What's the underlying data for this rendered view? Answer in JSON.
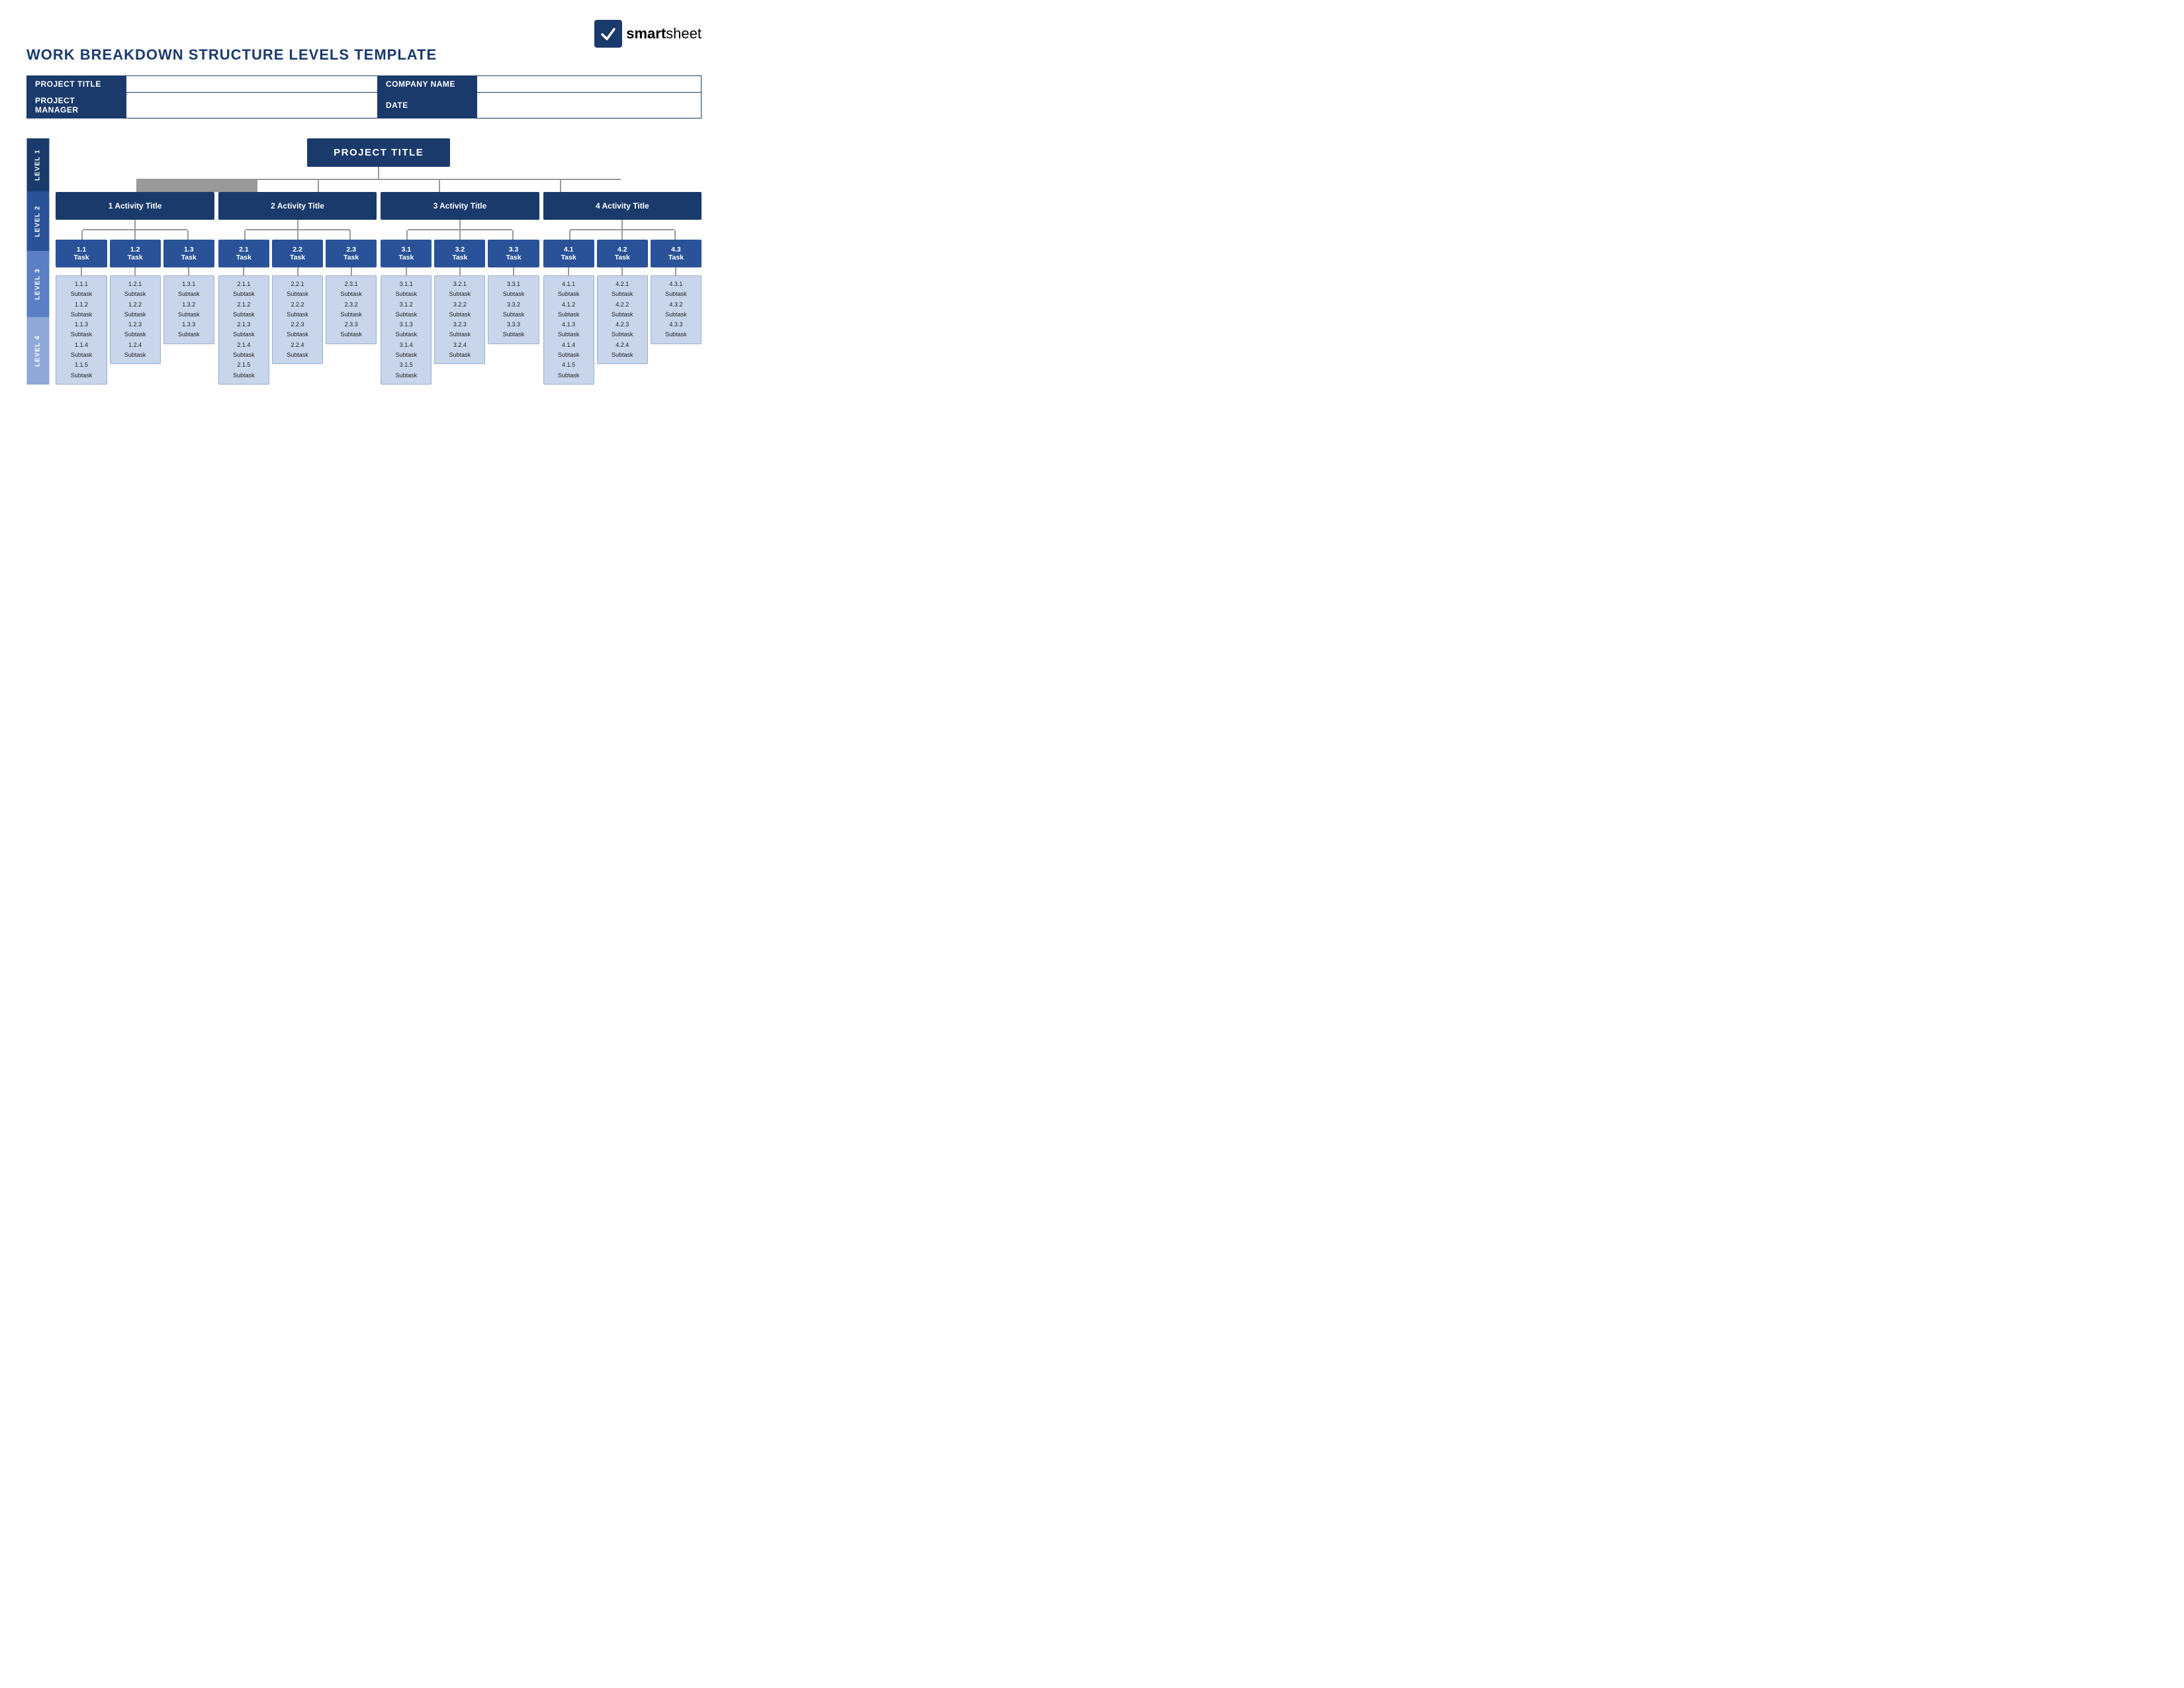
{
  "header": {
    "title": "WORK BREAKDOWN STRUCTURE LEVELS TEMPLATE",
    "logo_bold": "smart",
    "logo_light": "sheet"
  },
  "info_fields": [
    {
      "label": "PROJECT TITLE",
      "value": ""
    },
    {
      "label": "COMPANY NAME",
      "value": ""
    },
    {
      "label": "PROJECT MANAGER",
      "value": ""
    },
    {
      "label": "DATE",
      "value": ""
    }
  ],
  "levels": {
    "level1": "LEVEL 1",
    "level2": "LEVEL 2",
    "level3": "LEVEL 3",
    "level4": "LEVEL 4"
  },
  "project_title": "PROJECT TITLE",
  "activities": [
    {
      "title": "1 Activity Title",
      "tasks": [
        {
          "title": "1.1\nTask",
          "subtasks": [
            "1.1.1\nSubtask",
            "1.1.2\nSubtask",
            "1.1.3\nSubtask",
            "1.1.4\nSubtask",
            "1.1.5\nSubtask"
          ]
        },
        {
          "title": "1.2\nTask",
          "subtasks": [
            "1.2.1\nSubtask",
            "1.2.2\nSubtask",
            "1.2.3\nSubtask",
            "1.2.4\nSubtask"
          ]
        },
        {
          "title": "1.3\nTask",
          "subtasks": [
            "1.3.1\nSubtask",
            "1.3.2\nSubtask",
            "1.3.3\nSubtask"
          ]
        }
      ]
    },
    {
      "title": "2 Activity Title",
      "tasks": [
        {
          "title": "2.1\nTask",
          "subtasks": [
            "2.1.1\nSubtask",
            "2.1.2\nSubtask",
            "2.1.3\nSubtask",
            "2.1.4\nSubtask",
            "2.1.5\nSubtask"
          ]
        },
        {
          "title": "2.2\nTask",
          "subtasks": [
            "2.2.1\nSubtask",
            "2.2.2\nSubtask",
            "2.2.3\nSubtask",
            "2.2.4\nSubtask"
          ]
        },
        {
          "title": "2.3\nTask",
          "subtasks": [
            "2.3.1\nSubtask",
            "2.3.2\nSubtask",
            "2.3.3\nSubtask"
          ]
        }
      ]
    },
    {
      "title": "3 Activity Title",
      "tasks": [
        {
          "title": "3.1\nTask",
          "subtasks": [
            "3.1.1\nSubtask",
            "3.1.2\nSubtask",
            "3.1.3\nSubtask",
            "3.1.4\nSubtask",
            "3.1.5\nSubtask"
          ]
        },
        {
          "title": "3.2\nTask",
          "subtasks": [
            "3.2.1\nSubtask",
            "3.2.2\nSubtask",
            "3.2.3\nSubtask",
            "3.2.4\nSubtask"
          ]
        },
        {
          "title": "3.3\nTask",
          "subtasks": [
            "3.3.1\nSubtask",
            "3.3.2\nSubtask",
            "3.3.3\nSubtask"
          ]
        }
      ]
    },
    {
      "title": "4 Activity Title",
      "tasks": [
        {
          "title": "4.1\nTask",
          "subtasks": [
            "4.1.1\nSubtask",
            "4.1.2\nSubtask",
            "4.1.3\nSubtask",
            "4.1.4\nSubtask",
            "4.1.5\nSubtask"
          ]
        },
        {
          "title": "4.2\nTask",
          "subtasks": [
            "4.2.1\nSubtask",
            "4.2.2\nSubtask",
            "4.2.3\nSubtask",
            "4.2.4\nSubtask"
          ]
        },
        {
          "title": "4.3\nTask",
          "subtasks": [
            "4.3.1\nSubtask",
            "4.3.2\nSubtask",
            "4.3.3\nSubtask"
          ]
        }
      ]
    }
  ],
  "colors": {
    "level1_bg": "#1a3a6b",
    "level2_bg": "#2a5298",
    "level3_bg": "#5b7ec4",
    "level4_bg": "#8fa8d8",
    "subtask_bg": "#c8d5ea",
    "line_color": "#999999"
  }
}
